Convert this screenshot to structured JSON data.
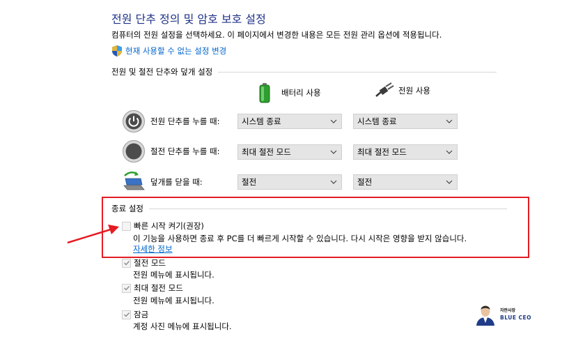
{
  "page": {
    "title": "전원 단추 정의 및 암호 보호 설정",
    "description": "컴퓨터의 전원 설정을 선택하세요. 이 페이지에서 변경한 내용은 모든 전원 관리 옵션에 적용됩니다.",
    "admin_link": "현재 사용할 수 없는 설정 변경"
  },
  "power_section": {
    "heading": "전원 및 절전 단추와 덮개 설정",
    "col_battery": "배터리 사용",
    "col_plugged": "전원 사용",
    "rows": [
      {
        "label": "전원 단추를 누를 때:",
        "battery": "시스템 종료",
        "plugged": "시스템 종료",
        "icon": "power-button-icon"
      },
      {
        "label": "절전 단추를 누를 때:",
        "battery": "최대 절전 모드",
        "plugged": "최대 절전 모드",
        "icon": "sleep-button-icon"
      },
      {
        "label": "덮개를 닫을 때:",
        "battery": "절전",
        "plugged": "절전",
        "icon": "laptop-lid-icon"
      }
    ]
  },
  "shutdown_section": {
    "heading": "종료 설정",
    "fast_startup": {
      "label": "빠른 시작 켜기(권장)",
      "checked": false,
      "description": "이 기능을 사용하면 종료 후 PC를 더 빠르게 시작할 수 있습니다. 다시 시작은 영향을 받지 않습니다.",
      "more_info": "자세한 정보"
    },
    "options": [
      {
        "label": "절전 모드",
        "description": "전원 메뉴에 표시됩니다.",
        "checked": true
      },
      {
        "label": "최대 절전 모드",
        "description": "전원 메뉴에 표시됩니다.",
        "checked": true
      },
      {
        "label": "잠금",
        "description": "계정 사진 메뉴에 표시됩니다.",
        "checked": true
      }
    ]
  },
  "watermark": {
    "name": "자판사장",
    "brand": "BLUE CEO"
  },
  "colors": {
    "title": "#1e3287",
    "link": "#0066cc",
    "highlight": "#e51c23",
    "dropdown_bg": "#e5e5e5"
  }
}
